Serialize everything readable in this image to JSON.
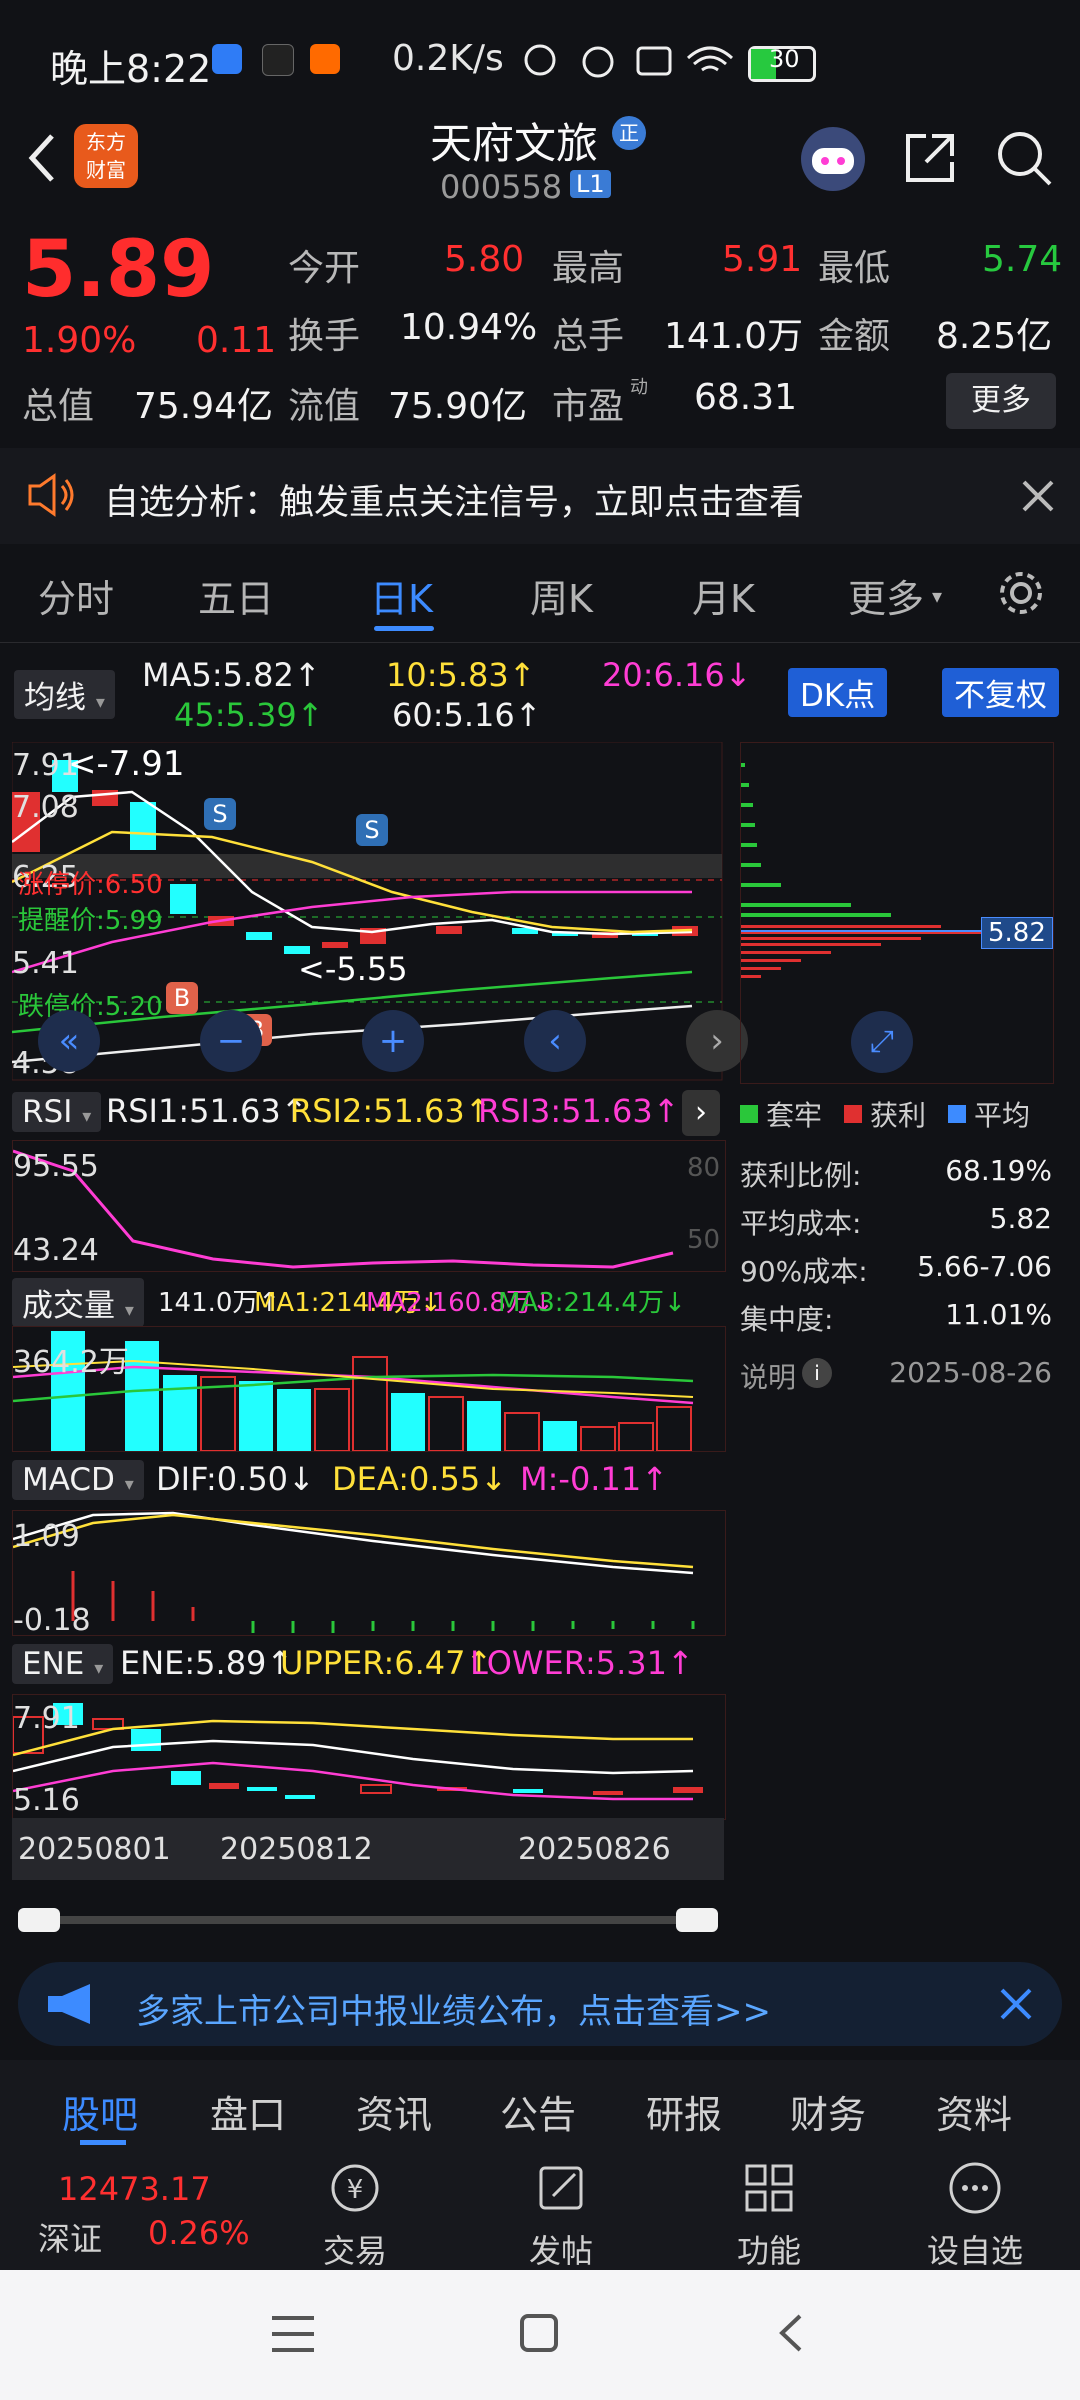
{
  "status_bar": {
    "time": "晚上8:22",
    "speed": "0.2K/s",
    "battery": "30"
  },
  "header": {
    "logo_text_1": "东方",
    "logo_text_2": "财富",
    "stock_name": "天府文旅",
    "stock_code": "000558",
    "level": "L1",
    "badge": "正"
  },
  "quote": {
    "price": "5.89",
    "change_pct": "1.90%",
    "change": "0.11",
    "open_label": "今开",
    "open": "5.80",
    "high_label": "最高",
    "high": "5.91",
    "low_label": "最低",
    "low": "5.74",
    "turnover_label": "换手",
    "turnover": "10.94%",
    "volume_label": "总手",
    "volume": "141.0万",
    "amount_label": "金额",
    "amount": "8.25亿",
    "mcap_label": "总值",
    "mcap": "75.94亿",
    "float_label": "流值",
    "float": "75.90亿",
    "pe_label": "市盈",
    "pe_sup": "动",
    "pe": "68.31",
    "more": "更多"
  },
  "alert": {
    "text": "自选分析：触发重点关注信号，立即点击查看"
  },
  "tabs": [
    "分时",
    "五日",
    "日K",
    "周K",
    "月K",
    "更多"
  ],
  "ma_bar": {
    "chip": "均线",
    "ma5": "MA5:5.82↑",
    "ma10": "10:5.83↑",
    "ma20": "20:6.16↓",
    "ma45": "45:5.39↑",
    "ma60": "60:5.16↑",
    "dk": "DK点",
    "fq": "不复权"
  },
  "kchart": {
    "y_top": "7.91",
    "y_2": "7.08",
    "y_3": "6.25",
    "y_4": "5.41",
    "y_bot": "4.58",
    "max_note": "<-7.91",
    "min_note": "<-5.55",
    "limit_up": "涨停价:6.50",
    "remind": "提醒价:5.99",
    "limit_down": "跌停价:5.20",
    "mark_s": "S",
    "mark_b": "B",
    "cost_tag": "5.82"
  },
  "cost_panel": {
    "legend": [
      "套牢",
      "获利",
      "平均"
    ],
    "rows": [
      {
        "label": "获利比例:",
        "value": "68.19%"
      },
      {
        "label": "平均成本:",
        "value": "5.82"
      },
      {
        "label": "90%成本:",
        "value": "5.66-7.06"
      },
      {
        "label": "集中度:",
        "value": "11.01%"
      }
    ],
    "note_label": "说明",
    "date": "2025-08-26"
  },
  "rsi": {
    "chip": "RSI",
    "rsi1": "RSI1:51.63↑",
    "rsi2": "RSI2:51.63↑",
    "rsi3": "RSI3:51.63↑",
    "y_top": "95.55",
    "y_bot": "43.24",
    "lvl_80": "80",
    "lvl_50": "50"
  },
  "vol": {
    "chip": "成交量",
    "v": "141.0万↑",
    "ma1": "MA1:214.4万↓",
    "ma2": "MA2:160.8万↓",
    "ma3": "MA3:214.4万↓",
    "y_top": "364.2万"
  },
  "macd": {
    "chip": "MACD",
    "dif": "DIF:0.50↓",
    "dea": "DEA:0.55↓",
    "m": "M:-0.11↑",
    "y_top": "1.09",
    "y_bot": "-0.18"
  },
  "ene": {
    "chip": "ENE",
    "ene": "ENE:5.89↑",
    "upper": "UPPER:6.47↑",
    "lower": "LOWER:5.31↑",
    "y_top": "7.91",
    "y_bot": "5.16"
  },
  "dates": [
    "20250801",
    "20250812",
    "20250826"
  ],
  "banner": {
    "text": "多家上市公司中报业绩公布，点击查看>>"
  },
  "bottom_tabs": [
    "股吧",
    "盘口",
    "资讯",
    "公告",
    "研报",
    "财务",
    "资料"
  ],
  "bottom_bar": {
    "index_value": "12473.17",
    "index_name": "深证",
    "index_change": "0.26%",
    "trade": "交易",
    "post": "发帖",
    "func": "功能",
    "watch": "设自选"
  },
  "colors": {
    "up": "#ff3030",
    "down": "#2ac73a",
    "accent": "#3d8bff",
    "ma5": "#ffffff",
    "ma10": "#ffe03a",
    "ma20": "#ff3dd4",
    "ma45": "#2ac73a"
  }
}
